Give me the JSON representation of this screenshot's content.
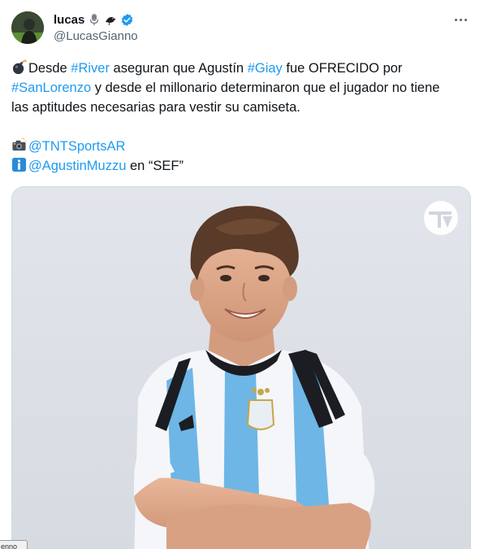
{
  "author": {
    "display_name": "lucas",
    "handle": "@LucasGianno",
    "emojis": [
      "microphone-icon",
      "bird-icon"
    ],
    "verified": true
  },
  "tweet": {
    "line1_emoji": "bomb-icon",
    "line1_pre": "Desde ",
    "hashtag_river": "#River",
    "line1_mid": " aseguran que Agustín ",
    "hashtag_giay": "#Giay",
    "line1_post": " fue OFRECIDO por",
    "hashtag_sanlorenzo": "#SanLorenzo",
    "line2_post": " y desde el millonario determinaron que el jugador no tiene",
    "line3": "las aptitudes necesarias para vestir su camiseta.",
    "credit_photo_icon": "camera-flash-icon",
    "mention_tnt": "@TNTSportsAR",
    "credit_info_icon": "info-icon",
    "mention_muzzu": "@AgustinMuzzu",
    "credit_suffix": " en “SEF”"
  },
  "media": {
    "logo": "tnt-sports-logo-icon"
  },
  "colors": {
    "link": "#1d9bf0",
    "text": "#0f1419",
    "secondary": "#536471",
    "border": "#cfd9de"
  },
  "bottom_tab": "enno"
}
